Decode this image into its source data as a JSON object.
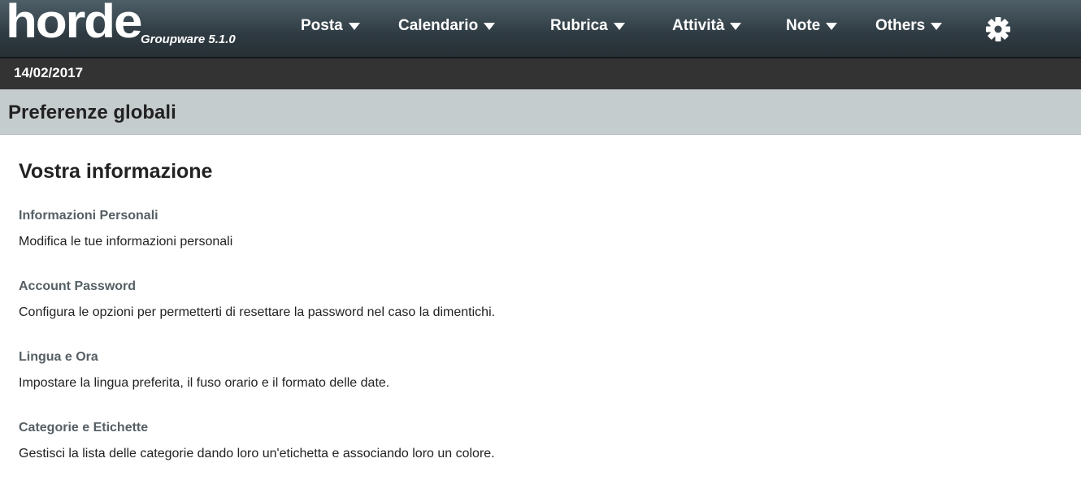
{
  "app": {
    "logo": "horde",
    "product": "Groupware 5.1.0"
  },
  "menu": [
    {
      "label": "Posta"
    },
    {
      "label": "Calendario"
    },
    {
      "label": "Rubrica"
    },
    {
      "label": "Attività"
    },
    {
      "label": "Note"
    },
    {
      "label": "Others"
    }
  ],
  "date": "14/02/2017",
  "page_title": "Preferenze globali",
  "section": {
    "title": "Vostra informazione",
    "items": [
      {
        "label": "Informazioni Personali",
        "desc": "Modifica le tue informazioni personali"
      },
      {
        "label": "Account Password",
        "desc": "Configura le opzioni per permetterti di resettare la password nel caso la dimentichi."
      },
      {
        "label": "Lingua e Ora",
        "desc": "Impostare la lingua preferita, il fuso orario e il formato delle date."
      },
      {
        "label": "Categorie e Etichette",
        "desc": "Gestisci la lista delle categorie dando loro un'etichetta e associando loro un colore."
      }
    ]
  },
  "icons": {
    "settings": "gear-icon",
    "menu_caret": "caret-down-icon"
  },
  "colors": {
    "topbar": "#2f3b42",
    "datebar": "#333333",
    "titlebar": "#c5ccce",
    "link": "#555f64"
  }
}
